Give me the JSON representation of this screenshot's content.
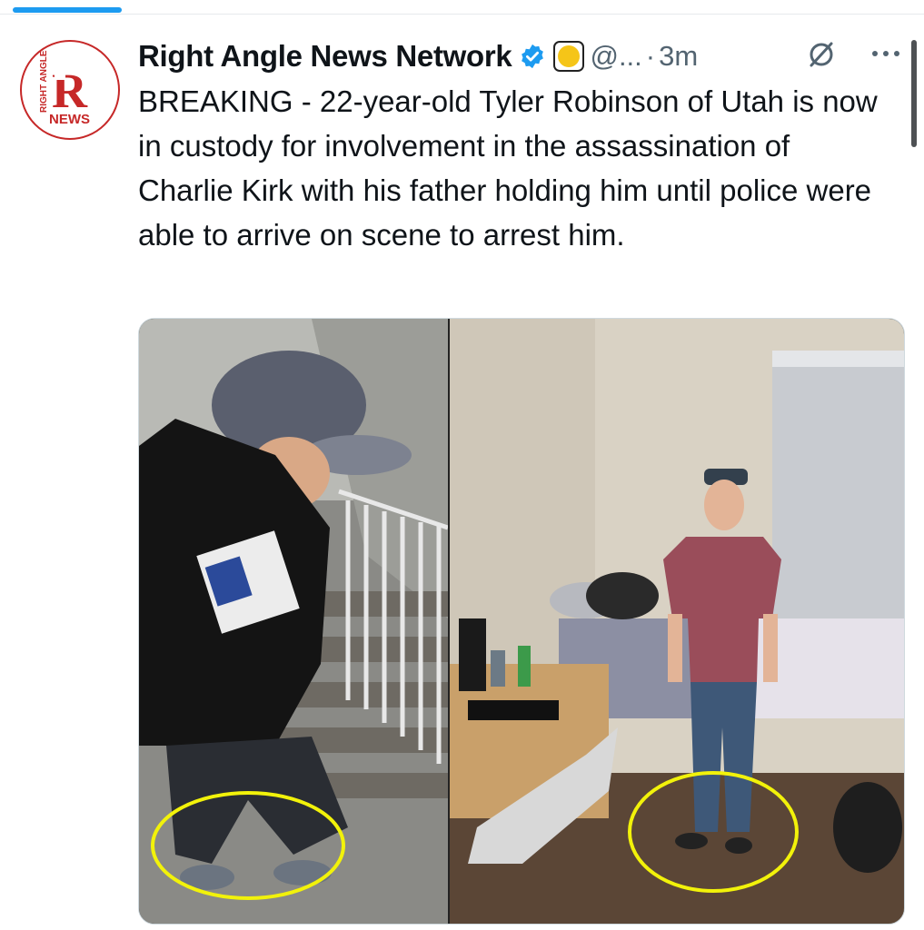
{
  "tweet": {
    "author_name": "Right Angle News Network",
    "handle": "@...",
    "separator": "·",
    "time": "3m",
    "text": "BREAKING - 22-year-old Tyler Robinson of Utah is now in custody for involvement in the assassination of Charlie Kirk with his father holding him until police were able to arrive on scene to arrest him."
  },
  "avatar": {
    "logo_letter": "R",
    "logo_side_text": "RIGHT ANGLE",
    "logo_bottom_text": "NEWS",
    "brand_color": "#c62828"
  },
  "icons": {
    "verified": "verified-badge-icon",
    "affiliate": "yellow-circle-badge-icon",
    "grok": "grok-icon",
    "more": "more-dots-icon"
  },
  "colors": {
    "verified_blue": "#1d9bf0",
    "affiliate_yellow": "#f5c518",
    "annotation_circle": "#f2f20a",
    "secondary_text": "#536471"
  }
}
